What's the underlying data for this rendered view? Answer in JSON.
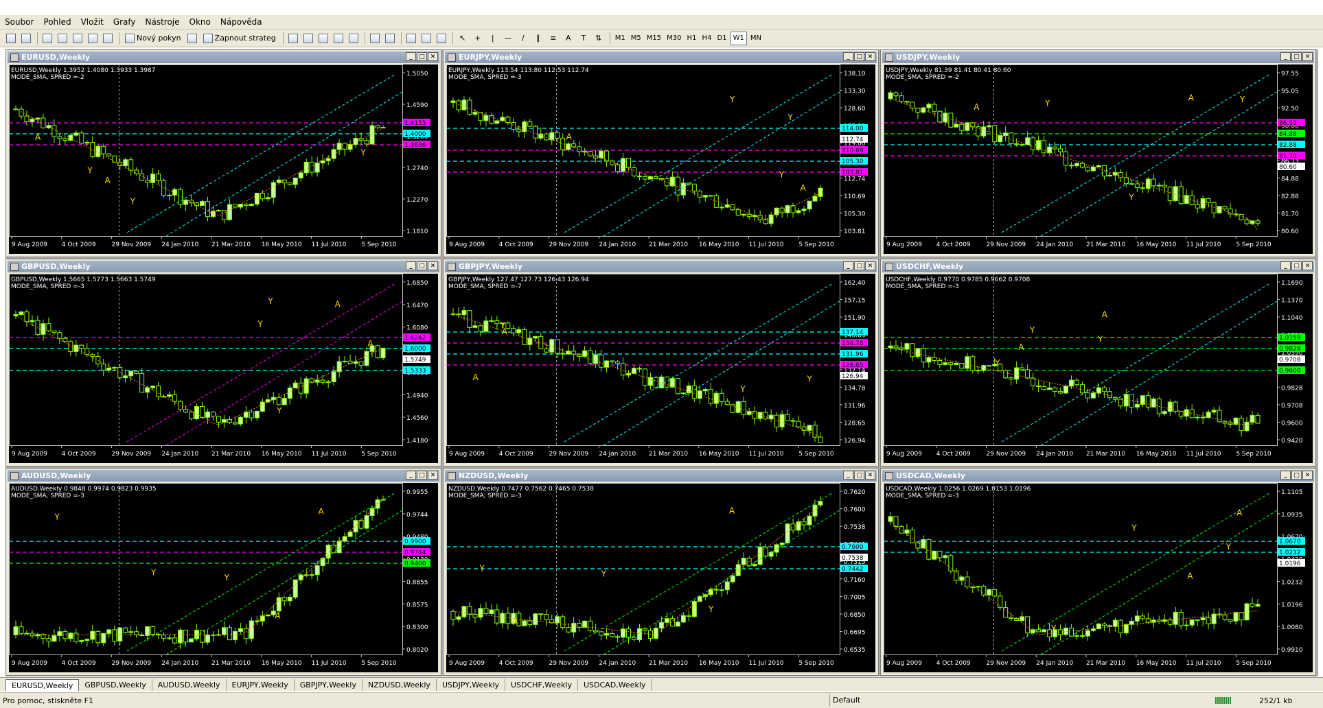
{
  "menu": [
    "Soubor",
    "Pohled",
    "Vložit",
    "Grafy",
    "Nástroje",
    "Okno",
    "Nápověda"
  ],
  "toolbar": {
    "new_order": "Nový pokyn",
    "autotrade": "Zapnout strateg",
    "timeframes": [
      "M1",
      "M5",
      "M15",
      "M30",
      "H1",
      "H4",
      "D1",
      "W1",
      "MN"
    ],
    "active_timeframe": "W1"
  },
  "x_dates": [
    "9 Aug 2009",
    "4 Oct 2009",
    "29 Nov 2009",
    "24 Jan 2010",
    "21 Mar 2010",
    "16 May 2010",
    "11 Jul 2010",
    "5 Sep 2010"
  ],
  "charts": [
    {
      "title": "EURUSD,Weekly",
      "info": "EURUSD,Weekly  1.3952 1.4080 1.3933 1.3987",
      "mode": "MODE_SMA, SPRED =-2",
      "ticks": [
        "1.5050",
        "1.4590",
        "1.3200",
        "1.2740",
        "1.2270",
        "1.1810"
      ],
      "labels": [
        {
          "t": "1.4155",
          "c": "#ff00ff"
        },
        {
          "t": "1.4000",
          "c": "#00ffff"
        },
        {
          "t": "1.3636",
          "c": "#ff00ff"
        }
      ],
      "ymin": 1.17,
      "ymax": 1.52,
      "start": 1.44,
      "peak": 0.3,
      "low": 0.55,
      "end": 1.4
    },
    {
      "title": "EURJPY,Weekly",
      "info": "EURJPY,Weekly  113.54 113.80 112.53 112.74",
      "mode": "MODE_SMA, SPRED =-3",
      "ticks": [
        "138.10",
        "133.30",
        "128.60",
        "123.80",
        "119.00",
        "114.00",
        "112.74",
        "110.69",
        "105.30",
        "103.81"
      ],
      "labels": [
        {
          "t": "114.00",
          "c": "#00ffff"
        },
        {
          "t": "112.74",
          "c": "#ffffff"
        },
        {
          "t": "110.69",
          "c": "#ff00ff"
        },
        {
          "t": "105.30",
          "c": "#00ffff"
        },
        {
          "t": "103.81",
          "c": "#ff00ff"
        }
      ],
      "ymin": 103,
      "ymax": 140,
      "start": 133,
      "peak": 0.12,
      "low": 0.85,
      "end": 112.7
    },
    {
      "title": "USDJPY,Weekly",
      "info": "USDJPY,Weekly  81.39 81.41 80.41 80.60",
      "mode": "MODE_SMA, SPRED =-2",
      "ticks": [
        "97.55",
        "95.05",
        "92.50",
        "90.00",
        "87.50",
        "86.13",
        "84.88",
        "82.88",
        "81.70",
        "80.60"
      ],
      "labels": [
        {
          "t": "86.13",
          "c": "#ff00ff"
        },
        {
          "t": "84.88",
          "c": "#00ff00"
        },
        {
          "t": "82.88",
          "c": "#00ffff"
        },
        {
          "t": "81.70",
          "c": "#ff00ff"
        },
        {
          "t": "80.60",
          "c": "#ffffff"
        }
      ],
      "ymin": 80,
      "ymax": 98,
      "start": 95,
      "peak": 0.5,
      "low": 0.98,
      "end": 80.6
    },
    {
      "title": "GBPUSD,Weekly",
      "info": "GBPUSD,Weekly  1.5665 1.5773 1.5663 1.5749",
      "mode": "MODE_SMA, SPRED =-3",
      "ticks": [
        "1.6850",
        "1.6470",
        "1.6080",
        "1.5749",
        "1.5333",
        "1.4940",
        "1.4560",
        "1.4180"
      ],
      "labels": [
        {
          "t": "1.6242",
          "c": "#ff00ff"
        },
        {
          "t": "1.6000",
          "c": "#00ffff"
        },
        {
          "t": "1.5749",
          "c": "#ffffff"
        },
        {
          "t": "1.5333",
          "c": "#00ffff"
        }
      ],
      "ymin": 1.41,
      "ymax": 1.69,
      "start": 1.63,
      "peak": 0.08,
      "low": 0.55,
      "end": 1.575
    },
    {
      "title": "GBPJPY,Weekly",
      "info": "GBPJPY,Weekly  127.47 127.73 126.43 126.94",
      "mode": "MODE_SMA, SPRED =-7",
      "ticks": [
        "162.40",
        "157.15",
        "151.90",
        "146.65",
        "141.40",
        "137.14",
        "134.78",
        "131.96",
        "128.65",
        "126.94"
      ],
      "labels": [
        {
          "t": "137.14",
          "c": "#00ffff"
        },
        {
          "t": "134.78",
          "c": "#ff00ff"
        },
        {
          "t": "131.96",
          "c": "#00ffff"
        },
        {
          "t": "128.65",
          "c": "#ff00ff"
        },
        {
          "t": "126.94",
          "c": "#ffffff"
        }
      ],
      "ymin": 125,
      "ymax": 164,
      "start": 156,
      "peak": 0.1,
      "low": 0.95,
      "end": 126.9
    },
    {
      "title": "USDCHF,Weekly",
      "info": "USDCHF,Weekly  0.9770 0.9785 0.9662 0.9708",
      "mode": "MODE_SMA, SPRED =-3",
      "ticks": [
        "1.1690",
        "1.1370",
        "1.1040",
        "1.0720",
        "1.0390",
        "1.0159",
        "0.9828",
        "0.9708",
        "0.9600",
        "0.9420"
      ],
      "labels": [
        {
          "t": "1.0159",
          "c": "#00ff00"
        },
        {
          "t": "0.9828",
          "c": "#00ff00"
        },
        {
          "t": "0.9708",
          "c": "#ffffff"
        },
        {
          "t": "0.9600",
          "c": "#00ff00"
        }
      ],
      "ymin": 0.935,
      "ymax": 1.18,
      "start": 1.08,
      "peak": 0.6,
      "low": 0.97,
      "end": 0.971
    },
    {
      "title": "AUDUSD,Weekly",
      "info": "AUDUSD,Weekly  0.9848 0.9974 0.9823 0.9935",
      "mode": "MODE_SMA, SPRED =-3",
      "ticks": [
        "0.9955",
        "0.9744",
        "0.9480",
        "0.9130",
        "0.8855",
        "0.8575",
        "0.8300",
        "0.8020"
      ],
      "labels": [
        {
          "t": "0.9900",
          "c": "#00ffff"
        },
        {
          "t": "0.9744",
          "c": "#ff00ff"
        },
        {
          "t": "0.9400",
          "c": "#00ff00"
        }
      ],
      "ymin": 0.795,
      "ymax": 1.005,
      "start": 0.82,
      "peak": 0.35,
      "low": 0.62,
      "end": 0.993
    },
    {
      "title": "NZDUSD,Weekly",
      "info": "NZDUSD,Weekly  0.7477 0.7562 0.7465 0.7538",
      "mode": "MODE_SMA, SPRED =-3",
      "ticks": [
        "0.7620",
        "0.7600",
        "0.7538",
        "0.7442",
        "0.7315",
        "0.7160",
        "0.7005",
        "0.6850",
        "0.6695",
        "0.6535"
      ],
      "labels": [
        {
          "t": "0.7600",
          "c": "#00ffff"
        },
        {
          "t": "0.7538",
          "c": "#ffffff"
        },
        {
          "t": "0.7442",
          "c": "#00ffff"
        }
      ],
      "ymin": 0.65,
      "ymax": 0.765,
      "start": 0.68,
      "peak": 0.15,
      "low": 0.55,
      "end": 0.7538
    },
    {
      "title": "USDCAD,Weekly",
      "info": "USDCAD,Weekly  1.0256 1.0269 1.0153 1.0196",
      "mode": "MODE_SMA, SPRED =-3",
      "ticks": [
        "1.1105",
        "1.0935",
        "1.0670",
        "1.0420",
        "1.0232",
        "1.0196",
        "1.0080",
        "0.9910"
      ],
      "labels": [
        {
          "t": "1.0670",
          "c": "#00ffff"
        },
        {
          "t": "1.0232",
          "c": "#00ffff"
        },
        {
          "t": "1.0196",
          "c": "#ffffff"
        }
      ],
      "ymin": 0.985,
      "ymax": 1.115,
      "start": 1.09,
      "peak": 0.05,
      "low": 0.4,
      "end": 1.0196
    }
  ],
  "tabs": [
    "EURUSD,Weekly",
    "GBPUSD,Weekly",
    "AUDUSD,Weekly",
    "EURJPY,Weekly",
    "GBPJPY,Weekly",
    "NZDUSD,Weekly",
    "USDJPY,Weekly",
    "USDCHF,Weekly",
    "USDCAD,Weekly"
  ],
  "active_tab": "EURUSD,Weekly",
  "status": {
    "help": "Pro pomoc, stiskněte F1",
    "profile": "Default",
    "traffic": "252/1 kb"
  },
  "colors": {
    "candle": "#ccff99",
    "wick": "#7fff00",
    "ma": "#ff8c00",
    "arrow": "#ffd700",
    "cyan": "#00ffff",
    "magenta": "#ff00ff",
    "green": "#00ff00"
  }
}
